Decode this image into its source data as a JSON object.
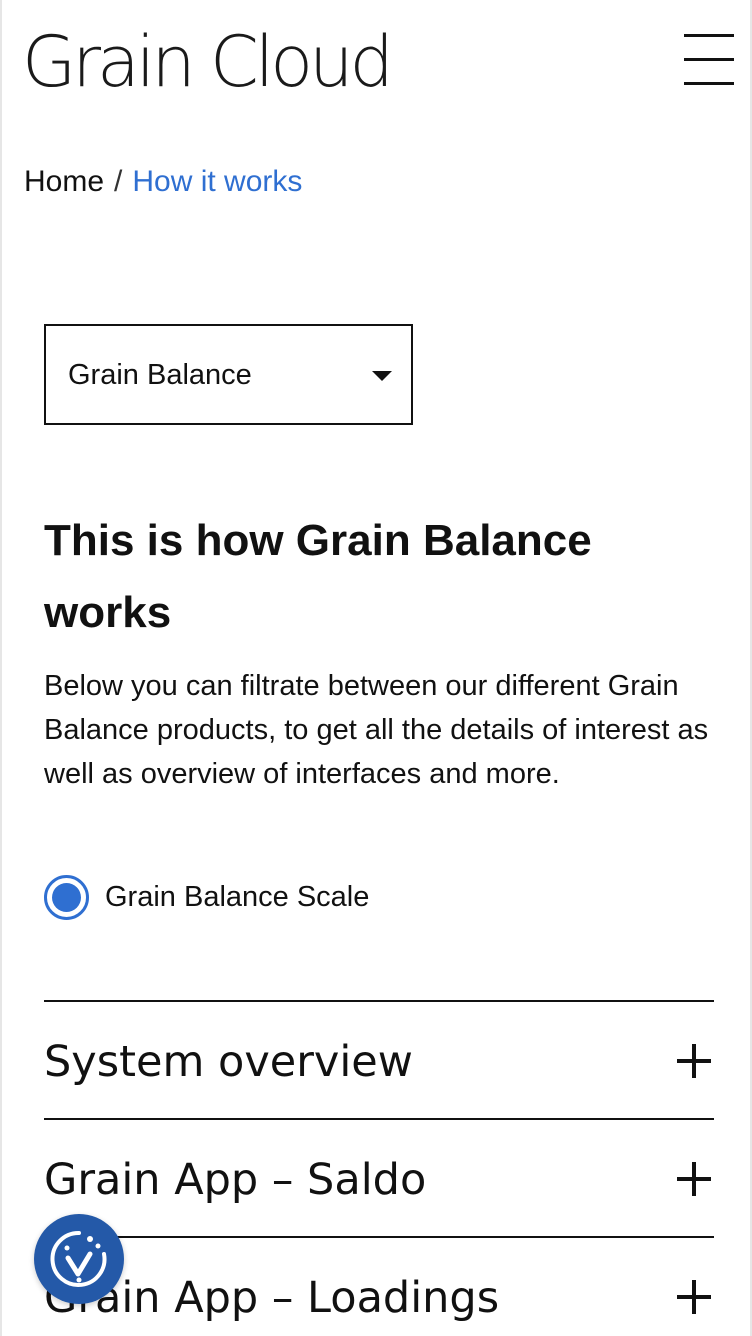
{
  "header": {
    "logo_text": "Grain Cloud",
    "menu_icon": "hamburger-menu-icon"
  },
  "breadcrumb": {
    "home": "Home",
    "separator": "/",
    "current": "How it works"
  },
  "product_select": {
    "selected": "Grain Balance",
    "icon": "caret-down-icon"
  },
  "main": {
    "heading": "This is how Grain Balance works",
    "intro": "Below you can filtrate between our different Grain Balance products, to get all the details of interest as well as overview of interfaces and more.",
    "radio_options": [
      {
        "label": "Grain Balance Scale",
        "selected": true
      }
    ]
  },
  "accordion": {
    "items": [
      {
        "title": "System overview",
        "expanded": false
      },
      {
        "title": "Grain App – Saldo",
        "expanded": false
      },
      {
        "title": "Grain App – Loadings",
        "expanded": false
      }
    ],
    "expand_icon": "plus-icon"
  },
  "cookie_consent": {
    "icon": "cookie-consent-icon"
  },
  "colors": {
    "accent": "#2f6fd1",
    "text": "#111111",
    "cookie_bg": "#2459a8"
  }
}
